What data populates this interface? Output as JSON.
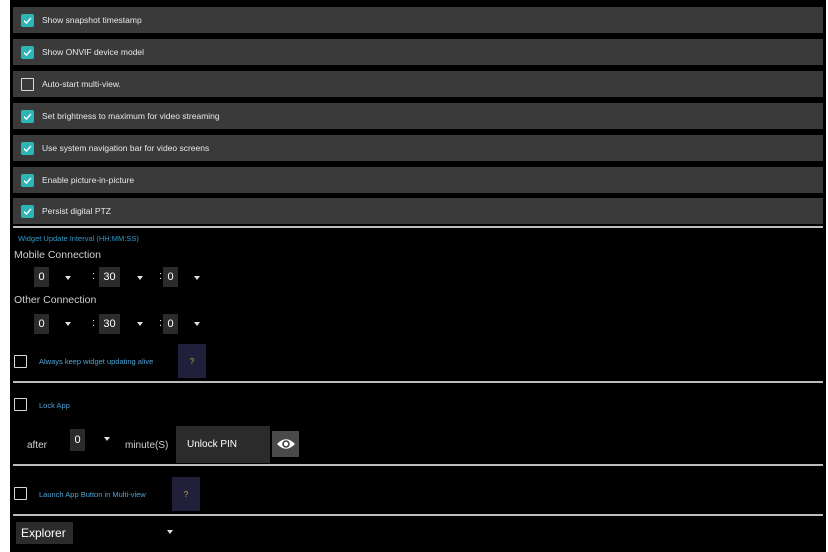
{
  "toggles": [
    {
      "label": "Show snapshot timestamp",
      "checked": true
    },
    {
      "label": "Show ONVIF device model",
      "checked": true
    },
    {
      "label": "Auto-start multi-view.",
      "checked": false
    },
    {
      "label": "Set brightness to maximum for video streaming",
      "checked": true
    },
    {
      "label": "Use system navigation bar for video screens",
      "checked": true
    },
    {
      "label": "Enable picture-in-picture",
      "checked": true
    },
    {
      "label": "Persist digital PTZ",
      "checked": true
    }
  ],
  "widget": {
    "title": "Widget Update Interval (HH:MM:SS)",
    "mobile_label": "Mobile Connection",
    "mobile": {
      "hh": "0",
      "mm": "30",
      "ss": "0"
    },
    "other_label": "Other Connection",
    "other": {
      "hh": "0",
      "mm": "30",
      "ss": "0"
    },
    "sep": ":",
    "keep_alive_label": "Always keep widget updating alive",
    "help": "?"
  },
  "lock": {
    "label": "Lock App",
    "after_label": "after",
    "minutes": "0",
    "minutes_unit": "minute(S)",
    "pin_label": "Unlock PIN"
  },
  "launch": {
    "label": "Launch App Button in Multi-view",
    "help": "?"
  },
  "explorer": {
    "selected": "Explorer"
  },
  "colors": {
    "accent": "#2bb5b5",
    "section_title": "#2e9ccd",
    "help": "#d6a72a"
  }
}
